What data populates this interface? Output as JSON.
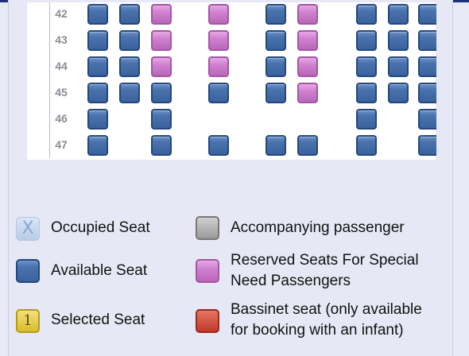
{
  "seat_map": {
    "rows": [
      {
        "number": "42",
        "seats": [
          "available",
          "available",
          "special",
          "special",
          "available",
          "special",
          "available",
          "available",
          "available"
        ]
      },
      {
        "number": "43",
        "seats": [
          "available",
          "available",
          "special",
          "special",
          "available",
          "special",
          "available",
          "available",
          "available"
        ]
      },
      {
        "number": "44",
        "seats": [
          "available",
          "available",
          "special",
          "special",
          "available",
          "special",
          "available",
          "available",
          "available"
        ]
      },
      {
        "number": "45",
        "seats": [
          "available",
          "available",
          "available",
          "available",
          "available",
          "special",
          "available",
          "available",
          "available"
        ]
      },
      {
        "number": "46",
        "seats": [
          "available",
          null,
          "available",
          null,
          null,
          null,
          "available",
          null,
          "available"
        ]
      },
      {
        "number": "47",
        "seats": [
          "available",
          null,
          "available",
          "available",
          "available",
          "available",
          "available",
          null,
          "available"
        ]
      }
    ]
  },
  "legend": {
    "occupied": {
      "label": "Occupied Seat",
      "glyph": "X",
      "icon": "occupied-seat-icon"
    },
    "accompanying": {
      "label": "Accompanying passenger",
      "icon": "accompanying-seat-icon"
    },
    "available": {
      "label": "Available Seat",
      "icon": "available-seat-icon"
    },
    "special": {
      "label_line1": "Reserved Seats For Special",
      "label_line2": "Need Passengers",
      "icon": "special-needs-seat-icon"
    },
    "selected": {
      "label": "Selected Seat",
      "glyph": "1",
      "icon": "selected-seat-icon"
    },
    "bassinet": {
      "label_line1": "Bassinet seat (only available",
      "label_line2": "for booking with an infant)",
      "icon": "bassinet-seat-icon"
    }
  },
  "colors": {
    "available": "#3a629e",
    "special": "#cf80cf",
    "selected": "#d8bd2e",
    "bassinet": "#c2382a",
    "accompanying": "#9a9a9a",
    "occupied": "#b7cce8"
  }
}
